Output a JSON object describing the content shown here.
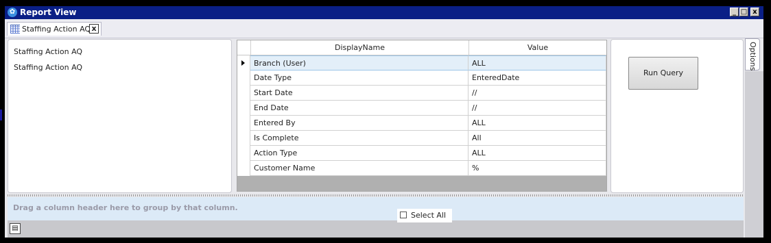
{
  "window": {
    "title": "Report View",
    "min_label": "_",
    "max_label": "□",
    "close_label": "x"
  },
  "tab": {
    "label": "Staffing Action AQ",
    "close_label": "x"
  },
  "left_panel": {
    "items": [
      "Staffing Action AQ",
      "Staffing Action AQ"
    ]
  },
  "grid": {
    "columns": [
      "DisplayName",
      "Value"
    ],
    "rows": [
      {
        "name": "Branch (User)",
        "value": "ALL"
      },
      {
        "name": "Date Type",
        "value": "EnteredDate"
      },
      {
        "name": "Start Date",
        "value": "//"
      },
      {
        "name": "End Date",
        "value": "//"
      },
      {
        "name": "Entered By",
        "value": "ALL"
      },
      {
        "name": "Is Complete",
        "value": "All"
      },
      {
        "name": "Action Type",
        "value": "ALL"
      },
      {
        "name": "Customer Name",
        "value": "%"
      }
    ],
    "active_row": 0
  },
  "run_query_label": "Run Query",
  "options_tab_label": "Options",
  "group_bar_hint": "Drag a column header here to group by that column.",
  "select_all_label": "Select All",
  "colors": {
    "title_bar": "#0a1f86",
    "group_bar": "#dceaf7",
    "active_row": "#e3eff9"
  }
}
